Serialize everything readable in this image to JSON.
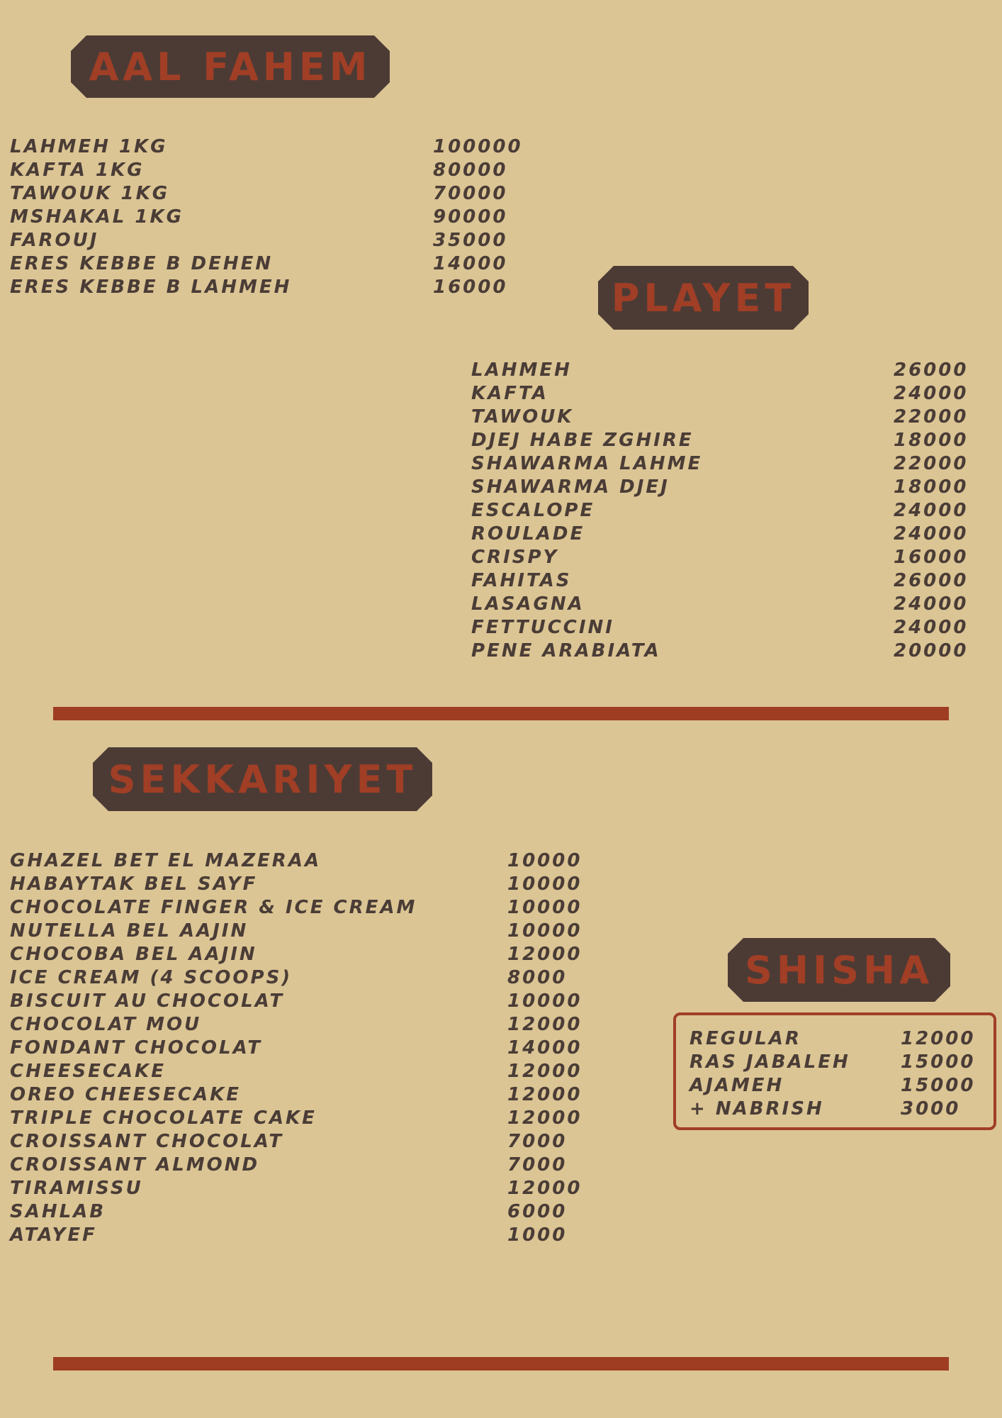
{
  "sections": {
    "aal_fahem": {
      "title": "AAL FAHEM",
      "items": [
        {
          "name": "LAHMEH 1KG",
          "price": "100000"
        },
        {
          "name": "KAFTA 1KG",
          "price": "80000"
        },
        {
          "name": "TAWOUK 1KG",
          "price": "70000"
        },
        {
          "name": "MSHAKAL 1KG",
          "price": "90000"
        },
        {
          "name": "FAROUJ",
          "price": "35000"
        },
        {
          "name": "ERES KEBBE B DEHEN",
          "price": "14000"
        },
        {
          "name": "ERES KEBBE B LAHMEH",
          "price": "16000"
        }
      ]
    },
    "playet": {
      "title": "PLAYET",
      "items": [
        {
          "name": "LAHMEH",
          "price": "26000"
        },
        {
          "name": "KAFTA",
          "price": "24000"
        },
        {
          "name": "TAWOUK",
          "price": "22000"
        },
        {
          "name": "DJEJ HABE ZGHIRE",
          "price": "18000"
        },
        {
          "name": "SHAWARMA LAHME",
          "price": "22000"
        },
        {
          "name": "SHAWARMA DJEJ",
          "price": "18000"
        },
        {
          "name": "ESCALOPE",
          "price": "24000"
        },
        {
          "name": "ROULADE",
          "price": "24000"
        },
        {
          "name": "CRISPY",
          "price": "16000"
        },
        {
          "name": "FAHITAS",
          "price": "26000"
        },
        {
          "name": "LASAGNA",
          "price": "24000"
        },
        {
          "name": "FETTUCCINI",
          "price": "24000"
        },
        {
          "name": "PENE ARABIATA",
          "price": "20000"
        }
      ]
    },
    "sekkariyet": {
      "title": "SEKKARIYET",
      "items": [
        {
          "name": "GHAZEL BET EL MAZERAA",
          "price": "10000"
        },
        {
          "name": "HABAYTAK BEL SAYF",
          "price": "10000"
        },
        {
          "name": "CHOCOLATE FINGER & ICE CREAM",
          "price": "10000"
        },
        {
          "name": "NUTELLA BEL AAJIN",
          "price": "10000"
        },
        {
          "name": "CHOCOBA BEL AAJIN",
          "price": "12000"
        },
        {
          "name": "ICE CREAM (4 SCOOPS)",
          "price": "8000"
        },
        {
          "name": "BISCUIT AU CHOCOLAT",
          "price": "10000"
        },
        {
          "name": "CHOCOLAT MOU",
          "price": "12000"
        },
        {
          "name": "FONDANT CHOCOLAT",
          "price": "14000"
        },
        {
          "name": "CHEESECAKE",
          "price": "12000"
        },
        {
          "name": "OREO CHEESECAKE",
          "price": "12000"
        },
        {
          "name": "TRIPLE CHOCOLATE CAKE",
          "price": "12000"
        },
        {
          "name": "CROISSANT CHOCOLAT",
          "price": "7000"
        },
        {
          "name": "CROISSANT ALMOND",
          "price": "7000"
        },
        {
          "name": "TIRAMISSU",
          "price": "12000"
        },
        {
          "name": "SAHLAB",
          "price": "6000"
        },
        {
          "name": "ATAYEF",
          "price": "1000"
        }
      ]
    },
    "shisha": {
      "title": "SHISHA",
      "items": [
        {
          "name": "REGULAR",
          "price": "12000"
        },
        {
          "name": "RAS JABALEH",
          "price": "15000"
        },
        {
          "name": "AJAMEH",
          "price": "15000"
        },
        {
          "name": "+ NABRISH",
          "price": "3000"
        }
      ]
    }
  },
  "colors": {
    "background": "#dbc594",
    "badge": "#4c3b35",
    "accent": "#a03e26",
    "text": "#4a3c36"
  }
}
